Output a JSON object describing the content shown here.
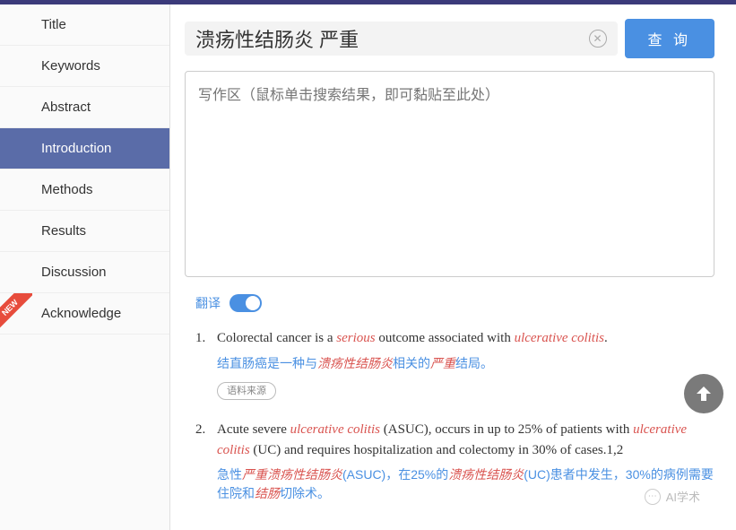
{
  "sidebar": {
    "items": [
      {
        "label": "Title"
      },
      {
        "label": "Keywords"
      },
      {
        "label": "Abstract"
      },
      {
        "label": "Introduction"
      },
      {
        "label": "Methods"
      },
      {
        "label": "Results"
      },
      {
        "label": "Discussion"
      },
      {
        "label": "Acknowledge"
      }
    ],
    "active_index": 3,
    "new_badge": "NEW"
  },
  "search": {
    "value": "溃疡性结肠炎 严重",
    "clear_symbol": "✕",
    "query_button": "查 询"
  },
  "writing_area": {
    "placeholder": "写作区（鼠标单击搜索结果，即可黏贴至此处）"
  },
  "translate": {
    "label": "翻译",
    "on": true
  },
  "results": [
    {
      "num": "1.",
      "en_parts": [
        "Colorectal cancer is a ",
        "serious",
        " outcome associated with ",
        "ulcerative colitis",
        "."
      ],
      "cn_parts": [
        "结直肠癌是一种与",
        "溃疡性结肠炎",
        "相关的",
        "严重",
        "结局。"
      ],
      "source_label": "语料来源"
    },
    {
      "num": "2.",
      "en_parts": [
        "Acute severe ",
        "ulcerative colitis",
        " (ASUC), occurs in up to 25% of patients with ",
        "ulcerative colitis",
        " (UC) and requires hospitalization and colectomy in 30% of cases.1,2"
      ],
      "cn_parts": [
        "急性",
        "严重溃疡性结肠炎",
        "(ASUC)，在25%的",
        "溃疡性结肠炎",
        "(UC)患者中发生，30%的病例需要住院和",
        "结肠",
        "切除术。"
      ]
    }
  ],
  "watermark": "AI学术"
}
